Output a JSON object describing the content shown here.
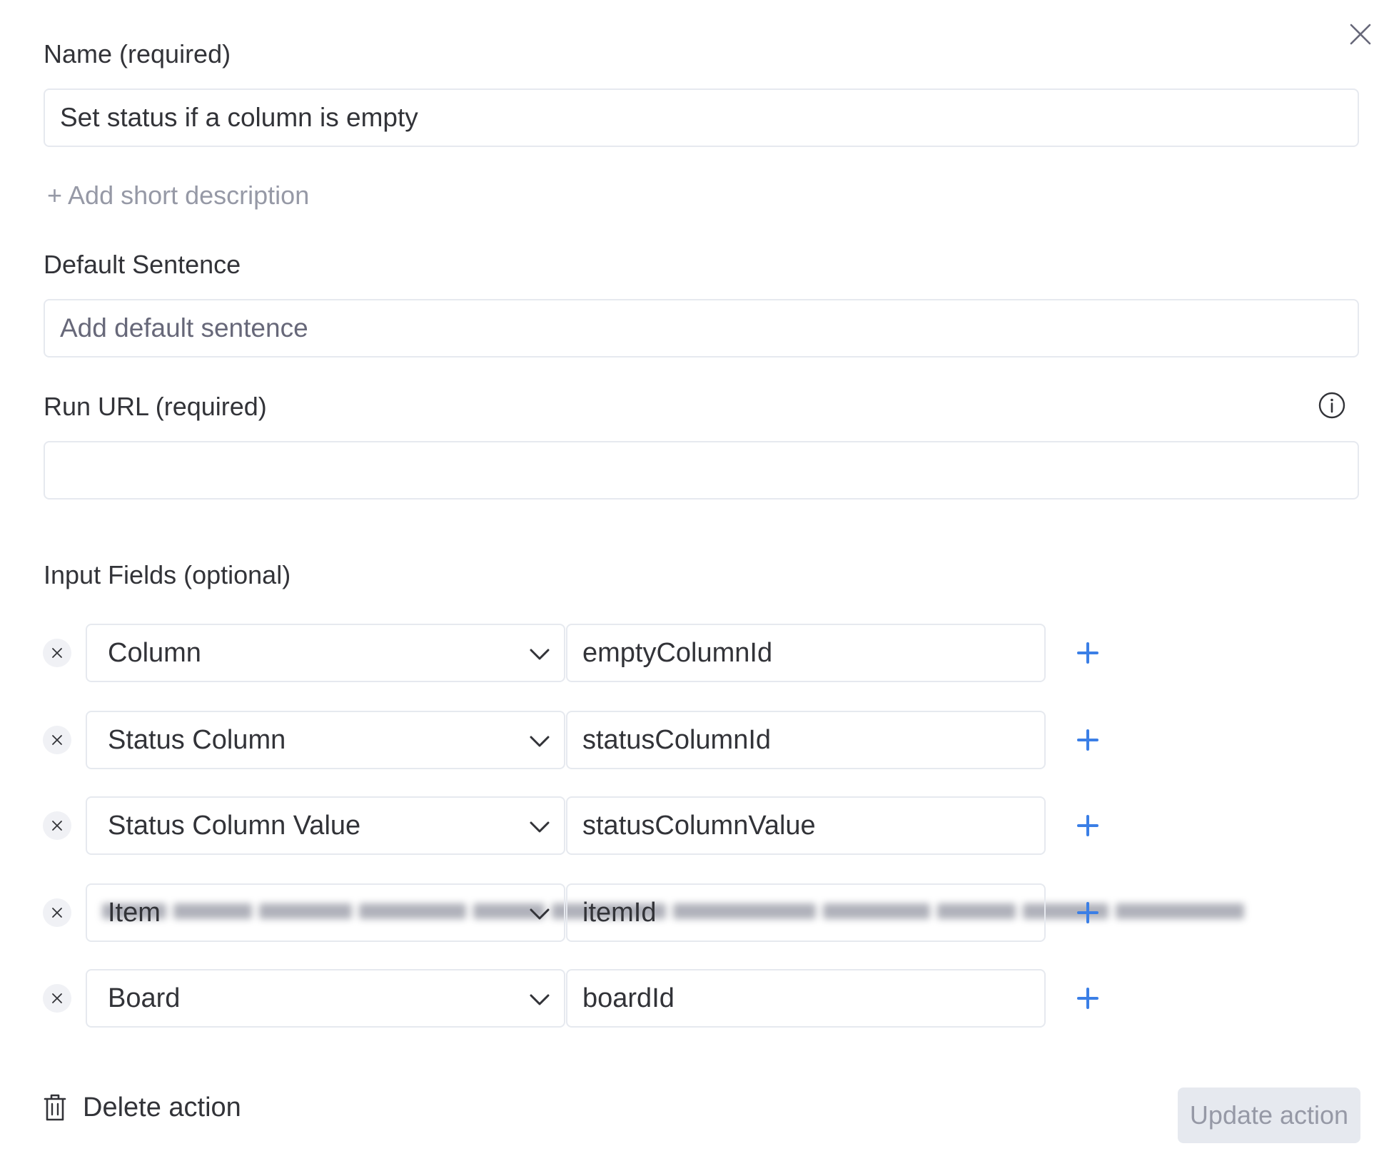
{
  "name_field": {
    "label": "Name (required)",
    "value": "Set status if a column is empty"
  },
  "add_description_link": "+ Add short description",
  "default_sentence_field": {
    "label": "Default Sentence",
    "value": "",
    "placeholder": "Add default sentence"
  },
  "run_url_field": {
    "label": "Run URL (required)",
    "value_redacted": true
  },
  "input_fields": {
    "label": "Input Fields (optional)",
    "rows": [
      {
        "type": "Column",
        "key": "emptyColumnId"
      },
      {
        "type": "Status Column",
        "key": "statusColumnId"
      },
      {
        "type": "Status Column Value",
        "key": "statusColumnValue"
      },
      {
        "type": "Item",
        "key": "itemId"
      },
      {
        "type": "Board",
        "key": "boardId"
      }
    ]
  },
  "footer": {
    "delete_label": "Delete action",
    "update_label": "Update action"
  },
  "icons": {
    "close": "close-icon",
    "info": "info-icon",
    "remove_row": "close-small-icon",
    "dropdown": "chevron-down-icon",
    "add_row": "plus-icon",
    "delete": "trash-icon"
  },
  "colors": {
    "accent": "#3b7fe6",
    "border": "#e6e9ef",
    "text": "#323338",
    "muted": "#9699a6",
    "disabled_bg": "#e6e9ef"
  }
}
